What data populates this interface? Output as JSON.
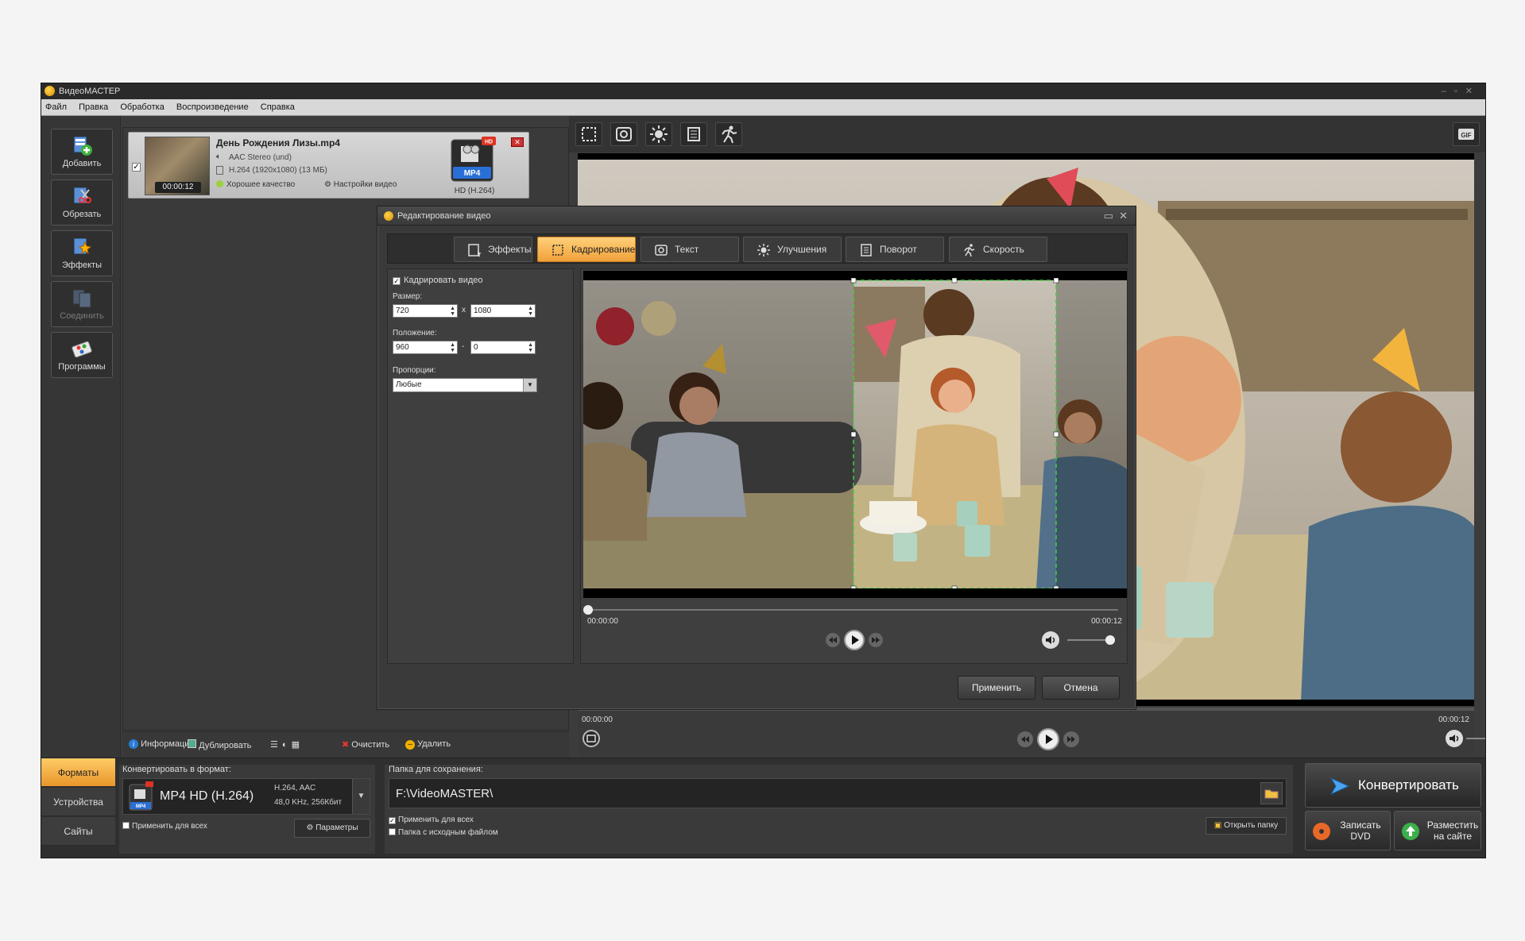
{
  "app": {
    "title": "ВидеоМАСТЕР",
    "menu": [
      "Файл",
      "Правка",
      "Обработка",
      "Воспроизведение",
      "Справка"
    ]
  },
  "leftbar": {
    "items": [
      {
        "label": "Добавить",
        "icon": "add-file-icon"
      },
      {
        "label": "Обрезать",
        "icon": "trim-icon"
      },
      {
        "label": "Эффекты",
        "icon": "effects-icon"
      },
      {
        "label": "Соединить",
        "icon": "join-icon"
      },
      {
        "label": "Программы",
        "icon": "programs-icon"
      }
    ]
  },
  "file": {
    "name": "День Рождения Лизы.mp4",
    "audio": "AAC Stereo (und)",
    "video": "H.264 (1920x1080) (13 МБ)",
    "duration": "00:00:12",
    "quality": "Хорошее качество",
    "video_settings": "Настройки видео",
    "format_badge": "MP4",
    "hd_badge": "HD",
    "format_label": "HD (H.264)",
    "checked": true
  },
  "list_tools": {
    "info": "Информация",
    "duplicate": "Дублировать",
    "clear": "Очистить",
    "delete": "Удалить"
  },
  "preview": {
    "time_start": "00:00:00",
    "time_end": "00:00:12",
    "progress": 0.0,
    "volume": 1.0
  },
  "dialog": {
    "title": "Редактирование видео",
    "tabs": [
      {
        "label": "Эффекты",
        "icon": "effects-icon",
        "active": false
      },
      {
        "label": "Кадрирование",
        "icon": "crop-icon",
        "active": true
      },
      {
        "label": "Текст",
        "icon": "text-icon",
        "active": false
      },
      {
        "label": "Улучшения",
        "icon": "brightness-icon",
        "active": false
      },
      {
        "label": "Поворот",
        "icon": "rotate-icon",
        "active": false
      },
      {
        "label": "Скорость",
        "icon": "speed-icon",
        "active": false
      }
    ],
    "crop_checkbox": "Кадрировать видео",
    "crop_checked": true,
    "size_label": "Размер:",
    "width": "720",
    "height": "1080",
    "size_sep": "x",
    "position_label": "Положение:",
    "pos_x": "960",
    "pos_y": "0",
    "pos_sep": "-",
    "ratio_label": "Пропорции:",
    "ratio_value": "Любые",
    "time_start": "00:00:00",
    "time_end": "00:00:12",
    "apply": "Применить",
    "cancel": "Отмена"
  },
  "bottom": {
    "tabs": [
      "Форматы",
      "Устройства",
      "Сайты"
    ],
    "active_tab": "Форматы",
    "convert_to_label": "Конвертировать в формат:",
    "format_name": "MP4 HD (H.264)",
    "format_codecs": "H.264, AAC",
    "format_details": "48,0 KHz, 256Кбит",
    "format_icon_badge": "MP4",
    "apply_all": "Применить для всех",
    "params": "Параметры",
    "save_folder_label": "Папка для сохранения:",
    "save_folder": "F:\\VideoMASTER\\",
    "apply_all_folder": "Применить для всех",
    "source_folder": "Папка с исходным файлом",
    "open_folder": "Открыть папку",
    "convert": "Конвертировать",
    "burn_dvd": "Записать DVD",
    "publish": "Разместить на сайте"
  }
}
